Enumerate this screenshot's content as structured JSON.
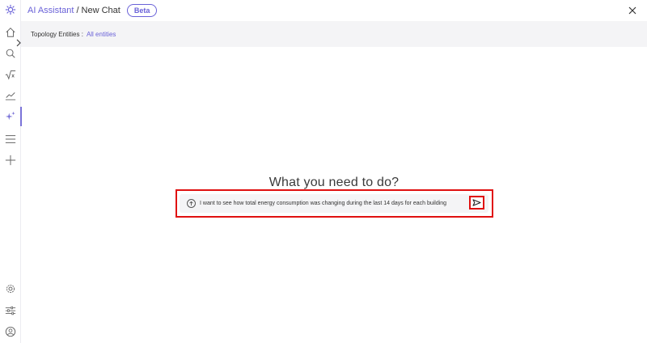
{
  "header": {
    "breadcrumb_link": "AI Assistant",
    "separator": "/",
    "current": "New Chat",
    "badge": "Beta",
    "close_icon": "close-icon"
  },
  "sidebar": {
    "items": [
      {
        "name": "logo",
        "icon": "gear-sparkle-logo-icon"
      },
      {
        "name": "home",
        "icon": "home-icon"
      },
      {
        "name": "search",
        "icon": "search-icon"
      },
      {
        "name": "formula",
        "icon": "sqrt-icon"
      },
      {
        "name": "trends",
        "icon": "trend-line-icon"
      },
      {
        "name": "ai-assistant",
        "icon": "sparkles-icon",
        "active": true
      },
      {
        "name": "menu",
        "icon": "hamburger-icon"
      },
      {
        "name": "add",
        "icon": "plus-icon"
      },
      {
        "name": "settings",
        "icon": "settings-icon"
      },
      {
        "name": "filters",
        "icon": "sliders-icon"
      },
      {
        "name": "profile",
        "icon": "user-circle-icon"
      }
    ],
    "expand_icon": "chevron-right-icon"
  },
  "topology": {
    "label": "Topology Entities :",
    "value": "All entities"
  },
  "main": {
    "title": "What you need to do?",
    "prompt_text": "I want to see how total energy consumption was changing during the last 14 days for each building",
    "send_icon": "send-icon"
  },
  "colors": {
    "accent": "#6a62d8",
    "highlight": "#e01010",
    "bar_bg": "#f4f4f6"
  }
}
